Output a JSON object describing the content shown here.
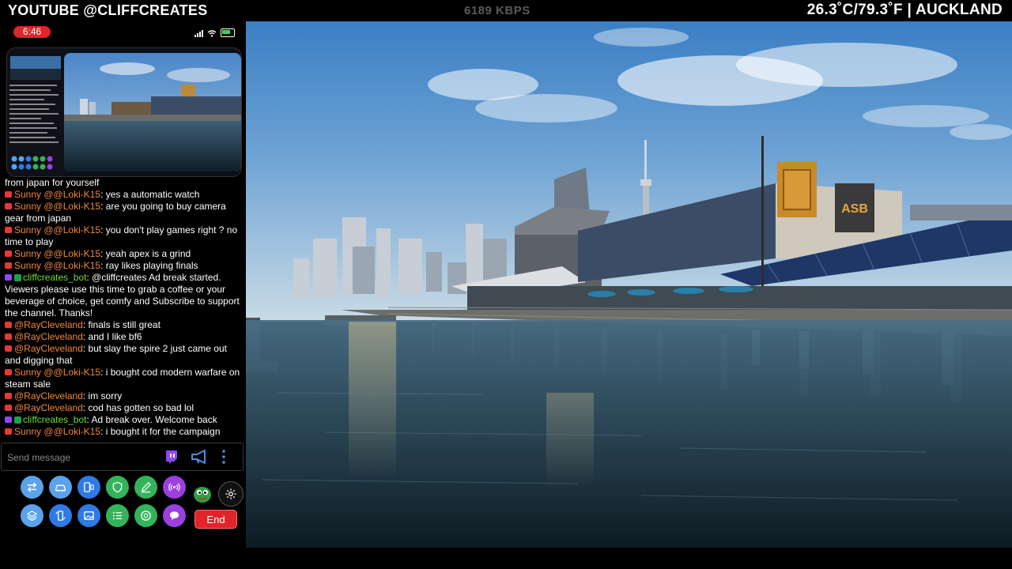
{
  "overlay": {
    "channel": "YOUTUBE @CLIFFCREATES",
    "bitrate": "6189 KBPS",
    "weather": "26.3˚C/79.3˚F | AUCKLAND"
  },
  "phone": {
    "time": "6:46",
    "battery_color": "#39d353"
  },
  "video": {
    "building_sign": "ASB"
  },
  "chat": {
    "messages": [
      {
        "user": "",
        "text": "from japan for yourself",
        "source": "",
        "color": ""
      },
      {
        "user": "Sunny @@Loki-K15",
        "text": ": yes a automatic watch",
        "source": "youtube",
        "color": "#f0873a"
      },
      {
        "user": "Sunny @@Loki-K15",
        "text": ": are you going to buy camera gear from japan",
        "source": "youtube",
        "color": "#f0873a"
      },
      {
        "user": "Sunny @@Loki-K15",
        "text": ": you don't play games right ? no time to play",
        "source": "youtube",
        "color": "#f0873a"
      },
      {
        "user": "Sunny @@Loki-K15",
        "text": ": yeah apex is a grind",
        "source": "youtube",
        "color": "#f0873a"
      },
      {
        "user": "Sunny @@Loki-K15",
        "text": ": ray likes playing finals",
        "source": "youtube",
        "color": "#f0873a"
      },
      {
        "user": "cliffcreates_bot",
        "text": ": @cliffcreates Ad break started. Viewers please use this time to grab a coffee or your beverage of choice, get comfy and Subscribe to support the channel. Thanks!",
        "source": "twitch",
        "color": "#6ede33"
      },
      {
        "user": "@RayCleveland",
        "text": ": finals is still great",
        "source": "youtube",
        "color": "#f0873a"
      },
      {
        "user": "@RayCleveland",
        "text": ": and I like bf6",
        "source": "youtube",
        "color": "#f0873a"
      },
      {
        "user": "@RayCleveland",
        "text": ": but slay the spire 2 just came out and digging that",
        "source": "youtube",
        "color": "#f0873a"
      },
      {
        "user": "Sunny @@Loki-K15",
        "text": ": i bought cod modern warfare on steam sale",
        "source": "youtube",
        "color": "#f0873a"
      },
      {
        "user": "@RayCleveland",
        "text": ": im sorry",
        "source": "youtube",
        "color": "#f0873a"
      },
      {
        "user": "@RayCleveland",
        "text": ": cod has gotten so bad lol",
        "source": "youtube",
        "color": "#f0873a"
      },
      {
        "user": "cliffcreates_bot",
        "text": ": Ad break over. Welcome back",
        "source": "twitch",
        "color": "#6ede33"
      },
      {
        "user": "Sunny @@Loki-K15",
        "text": ": i bought it for the campaign",
        "source": "youtube",
        "color": "#f0873a"
      }
    ],
    "input_placeholder": "Send message"
  },
  "actions": {
    "row1": [
      {
        "icon": "swap-arrows-icon",
        "color": "#5aa3ec"
      },
      {
        "icon": "car-icon",
        "color": "#5aa3ec"
      },
      {
        "icon": "phone-device-icon",
        "color": "#2f7ae5"
      },
      {
        "icon": "shield-icon",
        "color": "#34b45a"
      },
      {
        "icon": "pencil-icon",
        "color": "#34b45a"
      },
      {
        "icon": "broadcast-icon",
        "color": "#9b3fe0"
      }
    ],
    "row2": [
      {
        "icon": "layers-icon",
        "color": "#5aa3ec"
      },
      {
        "icon": "rotate-screen-icon",
        "color": "#2f7ae5"
      },
      {
        "icon": "image-icon",
        "color": "#2f7ae5"
      },
      {
        "icon": "list-icon",
        "color": "#34b45a"
      },
      {
        "icon": "aperture-icon",
        "color": "#34b45a"
      },
      {
        "icon": "chat-bubble-icon",
        "color": "#9b3fe0"
      }
    ],
    "end_label": "End"
  }
}
